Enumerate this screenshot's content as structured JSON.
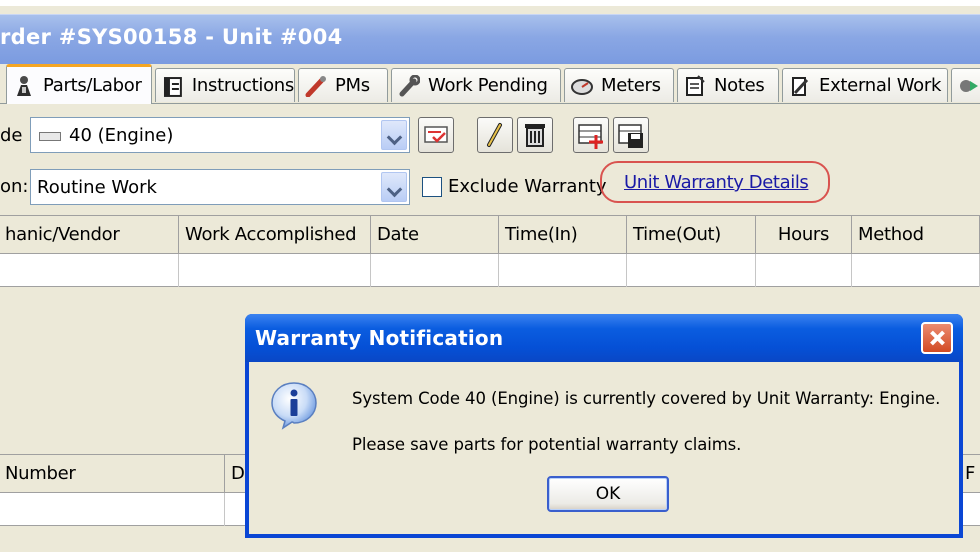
{
  "window": {
    "title": "rder #SYS00158 - Unit #004"
  },
  "tabs": [
    {
      "label": "Parts/Labor",
      "active": true,
      "icon": "wrench-person-icon"
    },
    {
      "label": "Instructions",
      "active": false,
      "icon": "clipboard-icon"
    },
    {
      "label": "PMs",
      "active": false,
      "icon": "wrench-red-icon"
    },
    {
      "label": "Work Pending",
      "active": false,
      "icon": "wrench-gray-icon"
    },
    {
      "label": "Meters",
      "active": false,
      "icon": "gauge-icon"
    },
    {
      "label": "Notes",
      "active": false,
      "icon": "notepad-icon"
    },
    {
      "label": "External Work",
      "active": false,
      "icon": "external-work-icon"
    }
  ],
  "form": {
    "system_code_label": "de",
    "system_code_value": "40 (Engine)",
    "reason_label": "on:",
    "reason_value": "Routine Work",
    "exclude_warranty_label": "Exclude Warranty",
    "exclude_warranty_checked": false,
    "unit_warranty_link": "Unit Warranty Details"
  },
  "labor_grid": {
    "columns": [
      "hanic/Vendor",
      "Work Accomplished",
      "Date",
      "Time(In)",
      "Time(Out)",
      "Hours",
      "Method"
    ]
  },
  "parts_grid": {
    "columns": [
      "Number",
      "D",
      "F"
    ]
  },
  "dialog": {
    "title": "Warranty Notification",
    "message_line1": "System Code 40 (Engine) is currently covered by Unit Warranty: Engine.",
    "message_line2": "Please save parts for potential warranty claims.",
    "ok_label": "OK"
  },
  "colors": {
    "title_bar": "#8aa7e4",
    "dialog_title": "#0550d6",
    "link": "#1a1aa6",
    "highlight_outline": "#d9534f"
  }
}
